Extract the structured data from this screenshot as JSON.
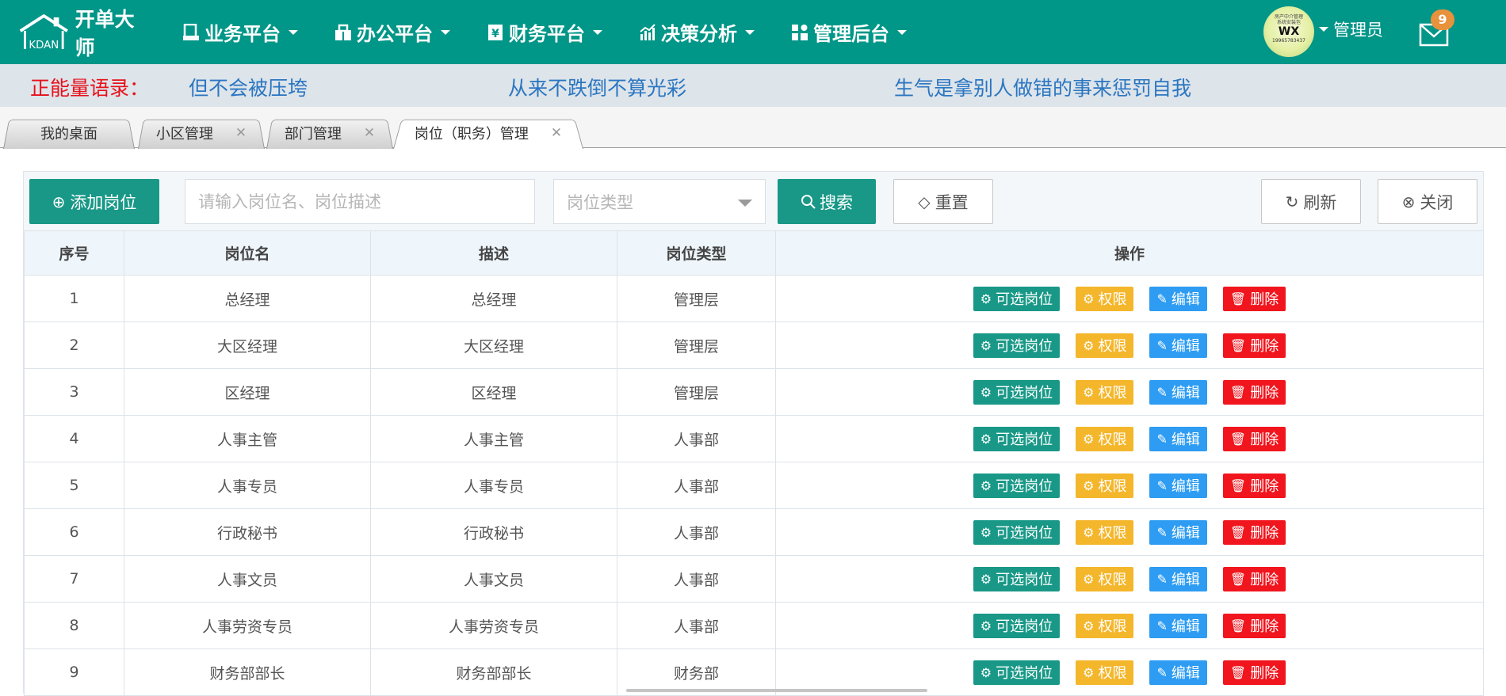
{
  "header": {
    "logo_text": "开单大师",
    "logo_mark": "KDAN",
    "nav": [
      {
        "label": "业务平台",
        "icon": "business-icon"
      },
      {
        "label": "办公平台",
        "icon": "office-icon"
      },
      {
        "label": "财务平台",
        "icon": "finance-icon"
      },
      {
        "label": "决策分析",
        "icon": "chart-icon"
      },
      {
        "label": "管理后台",
        "icon": "admin-icon"
      }
    ],
    "avatar": {
      "line1": "房产中介管理",
      "line2": "系统安装包",
      "wx": "WX",
      "number": "19965783437"
    },
    "user_label": "管理员",
    "mail_count": "9"
  },
  "quotes": {
    "label": "正能量语录：",
    "items": [
      "但不会被压垮",
      "从来不跌倒不算光彩",
      "生气是拿别人做错的事来惩罚自我"
    ]
  },
  "tabs": [
    {
      "label": "我的桌面",
      "closable": false
    },
    {
      "label": "小区管理",
      "closable": true
    },
    {
      "label": "部门管理",
      "closable": true
    },
    {
      "label": "岗位（职务）管理",
      "closable": true,
      "active": true
    }
  ],
  "toolbar": {
    "add_label": "添加岗位",
    "search_placeholder": "请输入岗位名、岗位描述",
    "type_placeholder": "岗位类型",
    "search_label": "搜索",
    "reset_label": "重置",
    "refresh_label": "刷新",
    "close_label": "关闭"
  },
  "table": {
    "headers": [
      "序号",
      "岗位名",
      "描述",
      "岗位类型",
      "操作"
    ],
    "actions": [
      "可选岗位",
      "权限",
      "编辑",
      "删除"
    ],
    "rows": [
      {
        "no": "1",
        "name": "总经理",
        "desc": "总经理",
        "type": "管理层"
      },
      {
        "no": "2",
        "name": "大区经理",
        "desc": "大区经理",
        "type": "管理层"
      },
      {
        "no": "3",
        "name": "区经理",
        "desc": "区经理",
        "type": "管理层"
      },
      {
        "no": "4",
        "name": "人事主管",
        "desc": "人事主管",
        "type": "人事部"
      },
      {
        "no": "5",
        "name": "人事专员",
        "desc": "人事专员",
        "type": "人事部"
      },
      {
        "no": "6",
        "name": "行政秘书",
        "desc": "行政秘书",
        "type": "人事部"
      },
      {
        "no": "7",
        "name": "人事文员",
        "desc": "人事文员",
        "type": "人事部"
      },
      {
        "no": "8",
        "name": "人事劳资专员",
        "desc": "人事劳资专员",
        "type": "人事部"
      },
      {
        "no": "9",
        "name": "财务部部长",
        "desc": "财务部部长",
        "type": "财务部"
      }
    ]
  },
  "colors": {
    "primary": "#009688",
    "button_teal": "#199887",
    "button_yellow": "#f4b62b",
    "button_blue": "#2d9cf2",
    "button_red": "#f1151d",
    "quote_label": "#e8101a",
    "quote_text": "#2b76c1"
  }
}
